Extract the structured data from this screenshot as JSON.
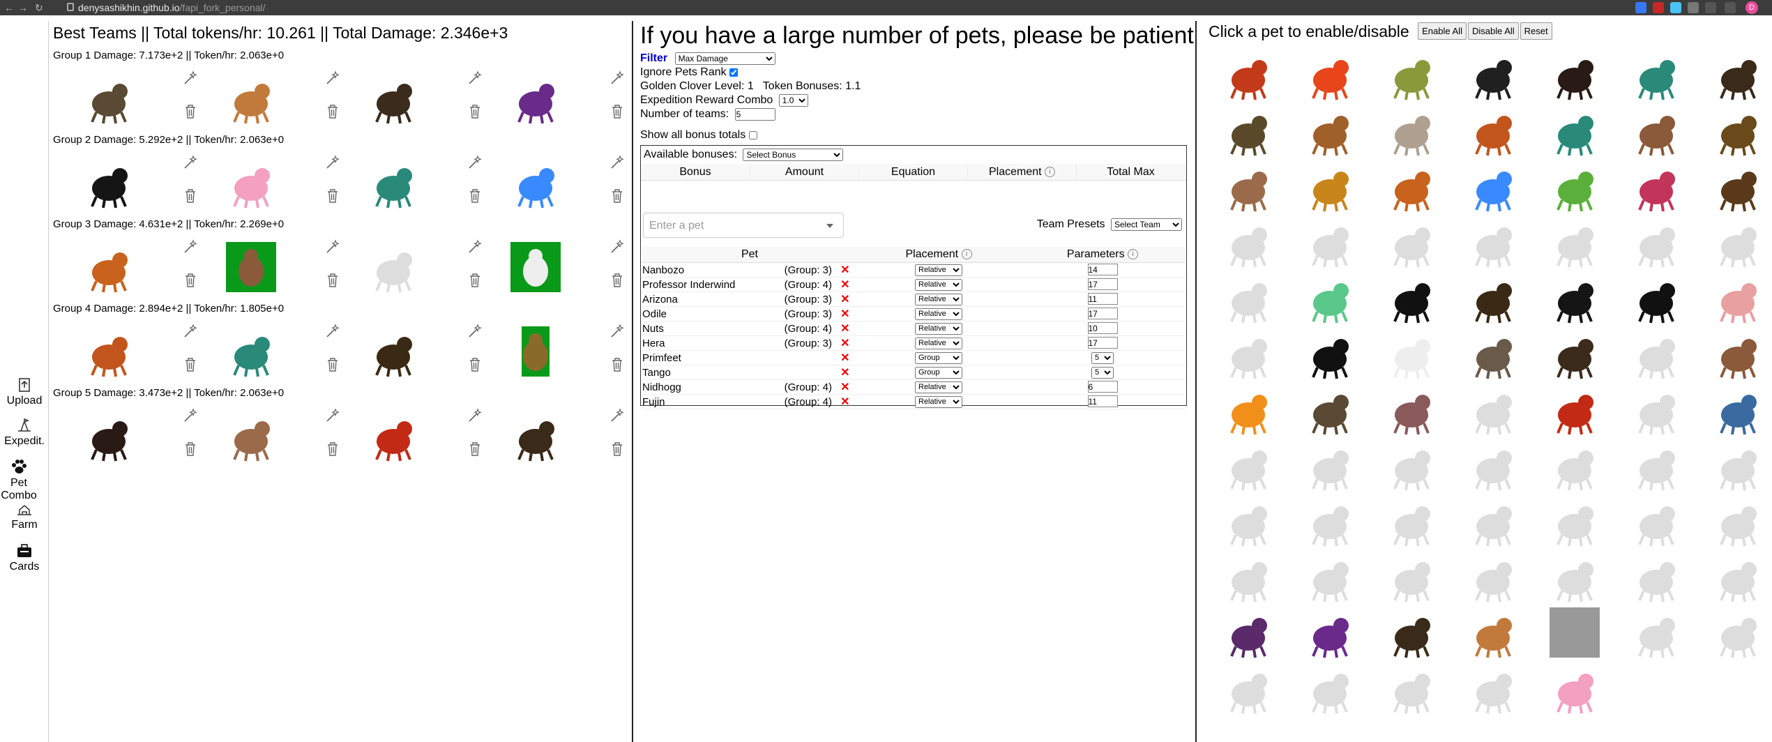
{
  "browser": {
    "url_host": "denysashikhin.github.io",
    "url_path": "/fapi_fork_personal/",
    "profile_initial": "D"
  },
  "sidebar": {
    "items": [
      {
        "label": "Upload",
        "icon": "upload-icon"
      },
      {
        "label": "Expedit.",
        "icon": "expedition-icon"
      },
      {
        "label": "Pet Combo",
        "icon": "paw-icon"
      },
      {
        "label": "Farm",
        "icon": "farm-icon"
      },
      {
        "label": "Cards",
        "icon": "cards-icon"
      }
    ]
  },
  "best_teams": {
    "title": "Best Teams || Total tokens/hr: 10.261 || Total Damage: 2.346e+3",
    "groups": [
      {
        "label": "Group 1 Damage: 7.173e+2 || Token/hr: 2.063e+0",
        "pets": [
          "tortoise",
          "gazelle",
          "eagle",
          "purple-dragon"
        ]
      },
      {
        "label": "Group 2 Damage: 5.292e+2 || Token/hr: 2.063e+0",
        "pets": [
          "black-dog",
          "cake",
          "hummingbird",
          "blue-blob"
        ]
      },
      {
        "label": "Group 3 Damage: 4.631e+2 || Token/hr: 2.269e+0",
        "pets": [
          "fox",
          "rabbit-green",
          "ghost-faint",
          "stork-green"
        ]
      },
      {
        "label": "Group 4 Damage: 2.894e+2 || Token/hr: 1.805e+0",
        "pets": [
          "squirrel",
          "dragonfly",
          "beetle",
          "robot-green"
        ]
      },
      {
        "label": "Group 5 Damage: 3.473e+2 || Token/hr: 2.063e+0",
        "pets": [
          "mole",
          "goat",
          "red-bird",
          "hawk"
        ]
      }
    ]
  },
  "middle": {
    "title": "If you have a large number of pets, please be patient",
    "filter_label": "Filter",
    "filter_value": "Max Damage",
    "ignore_rank_label": "Ignore Pets Rank",
    "clover_text": "Golden Clover Level: 1   Token Bonuses: 1.1",
    "expedition_label": "Expedition Reward Combo",
    "expedition_value": "1.0",
    "teams_label": "Number of teams:",
    "teams_value": "5",
    "show_bonus_label": "Show all bonus totals",
    "available_bonuses_label": "Available bonuses:",
    "bonus_select": "Select Bonus",
    "bonus_headers": [
      "Bonus",
      "Amount",
      "Equation",
      "Placement",
      "Total Max"
    ],
    "pet_placeholder": "Enter a pet",
    "team_presets_label": "Team Presets",
    "team_select": "Select Team",
    "pet_headers": [
      "Pet",
      "Placement",
      "Parameters"
    ],
    "pet_rows": [
      {
        "name": "Nanbozo",
        "group": "(Group: 3)",
        "placement": "Relative",
        "param": "14"
      },
      {
        "name": "Professor Inderwind",
        "group": "(Group: 4)",
        "placement": "Relative",
        "param": "17"
      },
      {
        "name": "Arizona",
        "group": "(Group: 3)",
        "placement": "Relative",
        "param": "11"
      },
      {
        "name": "Odile",
        "group": "(Group: 3)",
        "placement": "Relative",
        "param": "17"
      },
      {
        "name": "Nuts",
        "group": "(Group: 4)",
        "placement": "Relative",
        "param": "10"
      },
      {
        "name": "Hera",
        "group": "(Group: 3)",
        "placement": "Relative",
        "param": "17"
      },
      {
        "name": "Primfeet",
        "group": "",
        "placement": "Group",
        "param": "5"
      },
      {
        "name": "Tango",
        "group": "",
        "placement": "Group",
        "param": "5"
      },
      {
        "name": "Nidhogg",
        "group": "(Group: 4)",
        "placement": "Relative",
        "param": "6"
      },
      {
        "name": "Fujin",
        "group": "(Group: 4)",
        "placement": "Relative",
        "param": "11"
      }
    ]
  },
  "right": {
    "title": "Click a pet to enable/disable",
    "buttons": [
      "Enable All",
      "Disable All",
      "Reset"
    ],
    "pets": [
      {
        "k": "rooster",
        "on": true
      },
      {
        "k": "butterfly",
        "on": true
      },
      {
        "k": "frog",
        "on": true
      },
      {
        "k": "bat",
        "on": true
      },
      {
        "k": "mole",
        "on": true
      },
      {
        "k": "dragonfly",
        "on": true
      },
      {
        "k": "deer",
        "on": true
      },
      {
        "k": "orb",
        "on": true
      },
      {
        "k": "monkey",
        "on": true
      },
      {
        "k": "griffin",
        "on": true
      },
      {
        "k": "squirrel",
        "on": true
      },
      {
        "k": "hummingbird",
        "on": true
      },
      {
        "k": "shrew",
        "on": true
      },
      {
        "k": "bird-brown",
        "on": true
      },
      {
        "k": "goat",
        "on": true
      },
      {
        "k": "wasp",
        "on": true
      },
      {
        "k": "fox",
        "on": true
      },
      {
        "k": "blue-blob",
        "on": true
      },
      {
        "k": "chameleon",
        "on": true
      },
      {
        "k": "fairy",
        "on": true
      },
      {
        "k": "snail",
        "on": true
      },
      {
        "k": "fly",
        "on": false
      },
      {
        "k": "lizard",
        "on": false
      },
      {
        "k": "dragonfly-g",
        "on": false
      },
      {
        "k": "salamander",
        "on": false
      },
      {
        "k": "wyvern",
        "on": false
      },
      {
        "k": "hedgehog",
        "on": false
      },
      {
        "k": "bird-g",
        "on": false
      },
      {
        "k": "lemur",
        "on": false
      },
      {
        "k": "crystal",
        "on": true
      },
      {
        "k": "newt",
        "on": true
      },
      {
        "k": "beetle",
        "on": true
      },
      {
        "k": "black-dog",
        "on": true
      },
      {
        "k": "crow",
        "on": true
      },
      {
        "k": "pig",
        "on": true
      },
      {
        "k": "ghost",
        "on": false
      },
      {
        "k": "bull",
        "on": true
      },
      {
        "k": "stork",
        "on": true
      },
      {
        "k": "wolf",
        "on": true
      },
      {
        "k": "eagle",
        "on": true
      },
      {
        "k": "owl",
        "on": false
      },
      {
        "k": "rabbit",
        "on": true
      },
      {
        "k": "flame",
        "on": true
      },
      {
        "k": "tortoise",
        "on": true
      },
      {
        "k": "harpy",
        "on": true
      },
      {
        "k": "monk",
        "on": false
      },
      {
        "k": "red-bird",
        "on": true
      },
      {
        "k": "snake",
        "on": false
      },
      {
        "k": "robot",
        "on": true
      },
      {
        "k": "bear",
        "on": false
      },
      {
        "k": "panda",
        "on": false
      },
      {
        "k": "mantis",
        "on": false
      },
      {
        "k": "tiger",
        "on": false
      },
      {
        "k": "swan",
        "on": false
      },
      {
        "k": "elephant",
        "on": false
      },
      {
        "k": "red-dragon",
        "on": false
      },
      {
        "k": "crab",
        "on": false
      },
      {
        "k": "duck",
        "on": false
      },
      {
        "k": "ox",
        "on": false
      },
      {
        "k": "flamingo",
        "on": false
      },
      {
        "k": "heron",
        "on": false
      },
      {
        "k": "penguin",
        "on": false
      },
      {
        "k": "lion",
        "on": false
      },
      {
        "k": "parrot",
        "on": false
      },
      {
        "k": "bat-g",
        "on": false
      },
      {
        "k": "gecko",
        "on": false
      },
      {
        "k": "goblin",
        "on": false
      },
      {
        "k": "squid",
        "on": false
      },
      {
        "k": "phoenix",
        "on": false
      },
      {
        "k": "mushroom",
        "on": false
      },
      {
        "k": "antelope",
        "on": true
      },
      {
        "k": "purple-dragon",
        "on": true
      },
      {
        "k": "hawk",
        "on": true
      },
      {
        "k": "gazelle",
        "on": true
      },
      {
        "k": "grey-box",
        "on": true
      },
      {
        "k": "spider",
        "on": false
      },
      {
        "k": "seal",
        "on": false
      },
      {
        "k": "dove",
        "on": false
      },
      {
        "k": "crane",
        "on": false
      },
      {
        "k": "vulture",
        "on": false
      },
      {
        "k": "ice-dragon",
        "on": false
      },
      {
        "k": "cake",
        "on": true
      }
    ]
  },
  "colors": {
    "accent_link": "#0000cc",
    "remove_x": "#e00000"
  }
}
